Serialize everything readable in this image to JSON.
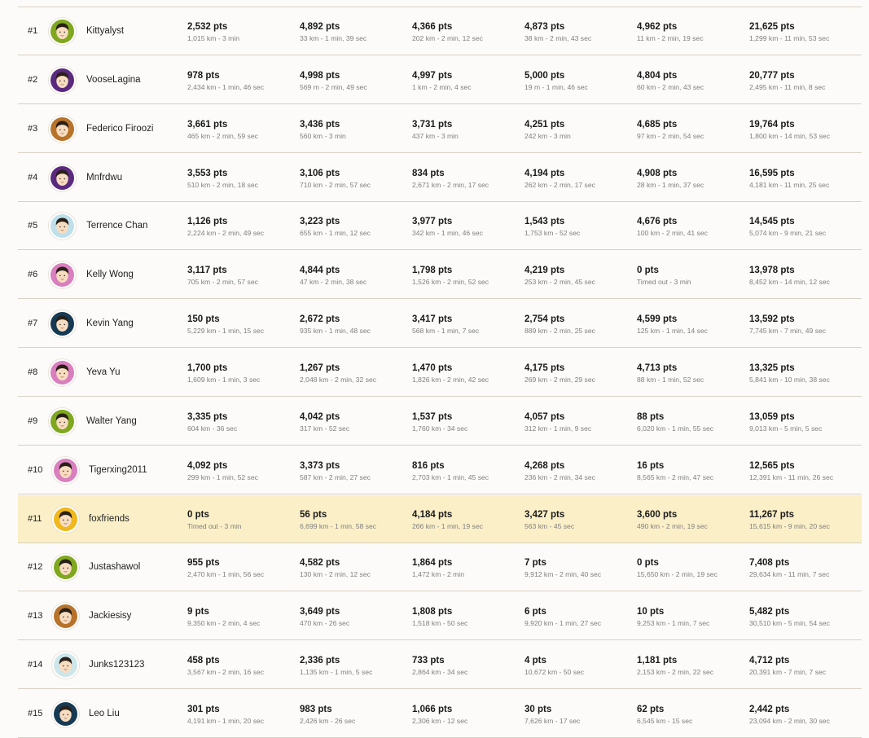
{
  "leaderboard": {
    "highlight_color": "#fbefc7",
    "rows": [
      {
        "rank": "#1",
        "name": "Kittyalyst",
        "avatar_color": "#7fa81f",
        "rounds": [
          {
            "pts": "2,532 pts",
            "detail": "1,015 km - 3 min"
          },
          {
            "pts": "4,892 pts",
            "detail": "33 km - 1 min, 39 sec"
          },
          {
            "pts": "4,366 pts",
            "detail": "202 km - 2 min, 12 sec"
          },
          {
            "pts": "4,873 pts",
            "detail": "38 km - 2 min, 43 sec"
          },
          {
            "pts": "4,962 pts",
            "detail": "11 km - 2 min, 19 sec"
          }
        ],
        "total": {
          "pts": "21,625 pts",
          "detail": "1,299 km - 11 min, 53 sec"
        }
      },
      {
        "rank": "#2",
        "name": "VooseLagina",
        "avatar_color": "#5a2a7e",
        "rounds": [
          {
            "pts": "978 pts",
            "detail": "2,434 km - 1 min, 46 sec"
          },
          {
            "pts": "4,998 pts",
            "detail": "569 m - 2 min, 49 sec"
          },
          {
            "pts": "4,997 pts",
            "detail": "1 km - 2 min, 4 sec"
          },
          {
            "pts": "5,000 pts",
            "detail": "19 m - 1 min, 46 sec"
          },
          {
            "pts": "4,804 pts",
            "detail": "60 km - 2 min, 43 sec"
          }
        ],
        "total": {
          "pts": "20,777 pts",
          "detail": "2,495 km - 11 min, 8 sec"
        }
      },
      {
        "rank": "#3",
        "name": "Federico Firoozi",
        "avatar_color": "#b8732a",
        "rounds": [
          {
            "pts": "3,661 pts",
            "detail": "465 km - 2 min, 59 sec"
          },
          {
            "pts": "3,436 pts",
            "detail": "560 km - 3 min"
          },
          {
            "pts": "3,731 pts",
            "detail": "437 km - 3 min"
          },
          {
            "pts": "4,251 pts",
            "detail": "242 km - 3 min"
          },
          {
            "pts": "4,685 pts",
            "detail": "97 km - 2 min, 54 sec"
          }
        ],
        "total": {
          "pts": "19,764 pts",
          "detail": "1,800 km - 14 min, 53 sec"
        }
      },
      {
        "rank": "#4",
        "name": "Mnfrdwu",
        "avatar_color": "#5a2a7e",
        "rounds": [
          {
            "pts": "3,553 pts",
            "detail": "510 km - 2 min, 18 sec"
          },
          {
            "pts": "3,106 pts",
            "detail": "710 km - 2 min, 57 sec"
          },
          {
            "pts": "834 pts",
            "detail": "2,671 km - 2 min, 17 sec"
          },
          {
            "pts": "4,194 pts",
            "detail": "262 km - 2 min, 17 sec"
          },
          {
            "pts": "4,908 pts",
            "detail": "28 km - 1 min, 37 sec"
          }
        ],
        "total": {
          "pts": "16,595 pts",
          "detail": "4,181 km - 11 min, 25 sec"
        }
      },
      {
        "rank": "#5",
        "name": "Terrence Chan",
        "avatar_color": "#bfe0ea",
        "rounds": [
          {
            "pts": "1,126 pts",
            "detail": "2,224 km - 2 min, 49 sec"
          },
          {
            "pts": "3,223 pts",
            "detail": "655 km - 1 min, 12 sec"
          },
          {
            "pts": "3,977 pts",
            "detail": "342 km - 1 min, 46 sec"
          },
          {
            "pts": "1,543 pts",
            "detail": "1,753 km - 52 sec"
          },
          {
            "pts": "4,676 pts",
            "detail": "100 km - 2 min, 41 sec"
          }
        ],
        "total": {
          "pts": "14,545 pts",
          "detail": "5,074 km - 9 min, 21 sec"
        }
      },
      {
        "rank": "#6",
        "name": "Kelly Wong",
        "avatar_color": "#d97fbe",
        "rounds": [
          {
            "pts": "3,117 pts",
            "detail": "705 km - 2 min, 57 sec"
          },
          {
            "pts": "4,844 pts",
            "detail": "47 km - 2 min, 38 sec"
          },
          {
            "pts": "1,798 pts",
            "detail": "1,526 km - 2 min, 52 sec"
          },
          {
            "pts": "4,219 pts",
            "detail": "253 km - 2 min, 45 sec"
          },
          {
            "pts": "0 pts",
            "detail": "Timed out - 3 min"
          }
        ],
        "total": {
          "pts": "13,978 pts",
          "detail": "8,452 km - 14 min, 12 sec"
        }
      },
      {
        "rank": "#7",
        "name": "Kevin Yang",
        "avatar_color": "#163a54",
        "rounds": [
          {
            "pts": "150 pts",
            "detail": "5,229 km - 1 min, 15 sec"
          },
          {
            "pts": "2,672 pts",
            "detail": "935 km - 1 min, 48 sec"
          },
          {
            "pts": "3,417 pts",
            "detail": "568 km - 1 min, 7 sec"
          },
          {
            "pts": "2,754 pts",
            "detail": "889 km - 2 min, 25 sec"
          },
          {
            "pts": "4,599 pts",
            "detail": "125 km - 1 min, 14 sec"
          }
        ],
        "total": {
          "pts": "13,592 pts",
          "detail": "7,745 km - 7 min, 49 sec"
        }
      },
      {
        "rank": "#8",
        "name": "Yeva Yu",
        "avatar_color": "#d97fbe",
        "rounds": [
          {
            "pts": "1,700 pts",
            "detail": "1,609 km - 1 min, 3 sec"
          },
          {
            "pts": "1,267 pts",
            "detail": "2,048 km - 2 min, 32 sec"
          },
          {
            "pts": "1,470 pts",
            "detail": "1,826 km - 2 min, 42 sec"
          },
          {
            "pts": "4,175 pts",
            "detail": "269 km - 2 min, 29 sec"
          },
          {
            "pts": "4,713 pts",
            "detail": "88 km - 1 min, 52 sec"
          }
        ],
        "total": {
          "pts": "13,325 pts",
          "detail": "5,841 km - 10 min, 38 sec"
        }
      },
      {
        "rank": "#9",
        "name": "Walter Yang",
        "avatar_color": "#7fa81f",
        "rounds": [
          {
            "pts": "3,335 pts",
            "detail": "604 km - 36 sec"
          },
          {
            "pts": "4,042 pts",
            "detail": "317 km - 52 sec"
          },
          {
            "pts": "1,537 pts",
            "detail": "1,760 km - 34 sec"
          },
          {
            "pts": "4,057 pts",
            "detail": "312 km - 1 min, 9 sec"
          },
          {
            "pts": "88 pts",
            "detail": "6,020 km - 1 min, 55 sec"
          }
        ],
        "total": {
          "pts": "13,059 pts",
          "detail": "9,013 km - 5 min, 5 sec"
        }
      },
      {
        "rank": "#10",
        "name": "Tigerxing2011",
        "avatar_color": "#d97fbe",
        "rounds": [
          {
            "pts": "4,092 pts",
            "detail": "299 km - 1 min, 52 sec"
          },
          {
            "pts": "3,373 pts",
            "detail": "587 km - 2 min, 27 sec"
          },
          {
            "pts": "816 pts",
            "detail": "2,703 km - 1 min, 45 sec"
          },
          {
            "pts": "4,268 pts",
            "detail": "236 km - 2 min, 34 sec"
          },
          {
            "pts": "16 pts",
            "detail": "8,565 km - 2 min, 47 sec"
          }
        ],
        "total": {
          "pts": "12,565 pts",
          "detail": "12,391 km - 11 min, 26 sec"
        }
      },
      {
        "rank": "#11",
        "name": "foxfriends",
        "avatar_color": "#f0b81c",
        "highlight": true,
        "rounds": [
          {
            "pts": "0 pts",
            "detail": "Timed out - 3 min"
          },
          {
            "pts": "56 pts",
            "detail": "6,699 km - 1 min, 58 sec"
          },
          {
            "pts": "4,184 pts",
            "detail": "266 km - 1 min, 19 sec"
          },
          {
            "pts": "3,427 pts",
            "detail": "563 km - 45 sec"
          },
          {
            "pts": "3,600 pts",
            "detail": "490 km - 2 min, 19 sec"
          }
        ],
        "total": {
          "pts": "11,267 pts",
          "detail": "15,615 km - 9 min, 20 sec"
        }
      },
      {
        "rank": "#12",
        "name": "Justashawol",
        "avatar_color": "#7fa81f",
        "rounds": [
          {
            "pts": "955 pts",
            "detail": "2,470 km - 1 min, 56 sec"
          },
          {
            "pts": "4,582 pts",
            "detail": "130 km - 2 min, 12 sec"
          },
          {
            "pts": "1,864 pts",
            "detail": "1,472 km - 2 min"
          },
          {
            "pts": "7 pts",
            "detail": "9,912 km - 2 min, 40 sec"
          },
          {
            "pts": "0 pts",
            "detail": "15,650 km - 2 min, 19 sec"
          }
        ],
        "total": {
          "pts": "7,408 pts",
          "detail": "29,634 km - 11 min, 7 sec"
        }
      },
      {
        "rank": "#13",
        "name": "Jackiesisy",
        "avatar_color": "#b8732a",
        "rounds": [
          {
            "pts": "9 pts",
            "detail": "9,350 km - 2 min, 4 sec"
          },
          {
            "pts": "3,649 pts",
            "detail": "470 km - 26 sec"
          },
          {
            "pts": "1,808 pts",
            "detail": "1,518 km - 50 sec"
          },
          {
            "pts": "6 pts",
            "detail": "9,920 km - 1 min, 27 sec"
          },
          {
            "pts": "10 pts",
            "detail": "9,253 km - 1 min, 7 sec"
          }
        ],
        "total": {
          "pts": "5,482 pts",
          "detail": "30,510 km - 5 min, 54 sec"
        }
      },
      {
        "rank": "#14",
        "name": "Junks123123",
        "avatar_color": "#cde6ea",
        "rounds": [
          {
            "pts": "458 pts",
            "detail": "3,567 km - 2 min, 16 sec"
          },
          {
            "pts": "2,336 pts",
            "detail": "1,135 km - 1 min, 5 sec"
          },
          {
            "pts": "733 pts",
            "detail": "2,864 km - 34 sec"
          },
          {
            "pts": "4 pts",
            "detail": "10,672 km - 50 sec"
          },
          {
            "pts": "1,181 pts",
            "detail": "2,153 km - 2 min, 22 sec"
          }
        ],
        "total": {
          "pts": "4,712 pts",
          "detail": "20,391 km - 7 min, 7 sec"
        }
      },
      {
        "rank": "#15",
        "name": "Leo Liu",
        "avatar_color": "#163a54",
        "rounds": [
          {
            "pts": "301 pts",
            "detail": "4,191 km - 1 min, 20 sec"
          },
          {
            "pts": "983 pts",
            "detail": "2,426 km - 26 sec"
          },
          {
            "pts": "1,066 pts",
            "detail": "2,306 km - 12 sec"
          },
          {
            "pts": "30 pts",
            "detail": "7,626 km - 17 sec"
          },
          {
            "pts": "62 pts",
            "detail": "6,545 km - 15 sec"
          }
        ],
        "total": {
          "pts": "2,442 pts",
          "detail": "23,094 km - 2 min, 30 sec"
        }
      }
    ]
  }
}
